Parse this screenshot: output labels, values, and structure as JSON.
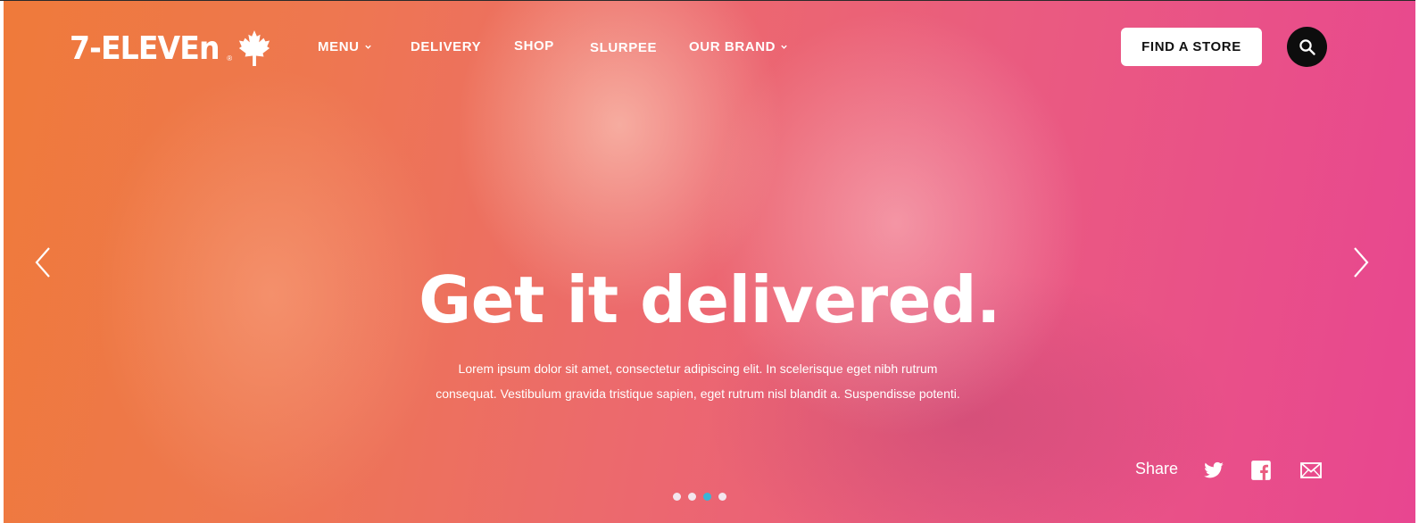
{
  "brand": {
    "logo_text": "7-ELEVEn",
    "registered": "®"
  },
  "nav": {
    "items": [
      {
        "label": "MENU",
        "has_dropdown": true
      },
      {
        "label": "DELIVERY",
        "has_dropdown": false
      },
      {
        "label": "SHOP",
        "has_dropdown": false
      },
      {
        "label": "SLURPEE",
        "has_dropdown": false
      },
      {
        "label": "OUR BRAND",
        "has_dropdown": true
      }
    ],
    "find_store_label": "FIND A STORE",
    "search_icon": "search-icon"
  },
  "hero": {
    "headline": "Get it delivered.",
    "body_line1": "Lorem ipsum dolor sit amet, consectetur adipiscing elit. In scelerisque eget nibh rutrum",
    "body_line2": "consequat. Vestibulum gravida tristique sapien, eget rutrum nisl blandit a. Suspendisse potenti.",
    "prev_icon": "chevron-left-icon",
    "next_icon": "chevron-right-icon",
    "slide_count": 4,
    "active_slide": 3
  },
  "share": {
    "label": "Share",
    "icons": [
      "twitter-icon",
      "facebook-icon",
      "email-icon"
    ]
  },
  "colors": {
    "gradient_start": "#ef7a3a",
    "gradient_end": "#e84690",
    "search_button": "#0d0d0d",
    "active_dot": "#39b5d6"
  }
}
